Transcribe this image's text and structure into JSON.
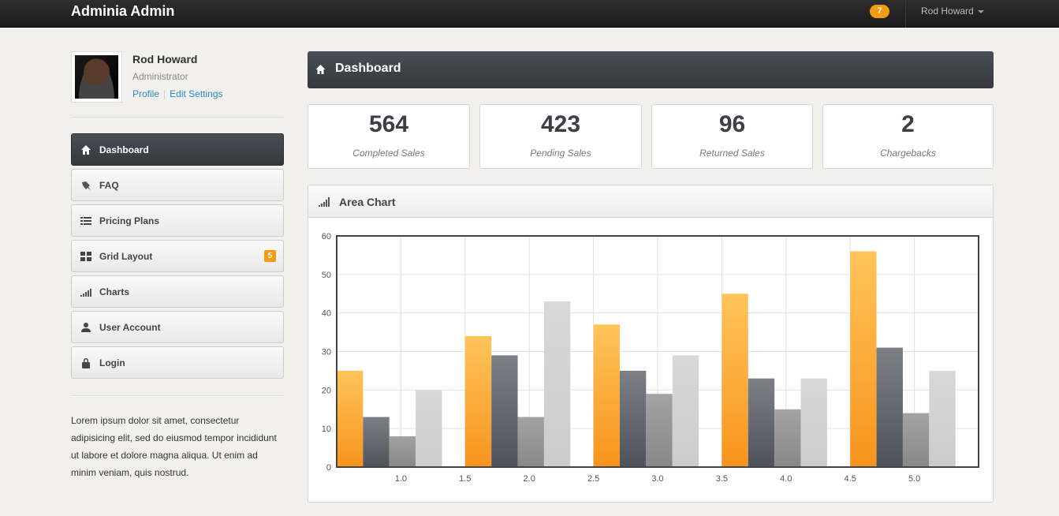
{
  "app": {
    "brand": "Adminia Admin",
    "notifications": "7",
    "user_menu": "Rod Howard"
  },
  "profile": {
    "name": "Rod Howard",
    "role": "Administrator",
    "profile_link": "Profile",
    "settings_link": "Edit Settings"
  },
  "nav": {
    "items": [
      {
        "label": "Dashboard",
        "icon": "home-icon"
      },
      {
        "label": "FAQ",
        "icon": "pushpin-icon"
      },
      {
        "label": "Pricing Plans",
        "icon": "list-icon"
      },
      {
        "label": "Grid Layout",
        "icon": "grid-icon",
        "badge": "5"
      },
      {
        "label": "Charts",
        "icon": "signal-icon"
      },
      {
        "label": "User Account",
        "icon": "user-icon"
      },
      {
        "label": "Login",
        "icon": "lock-icon"
      }
    ]
  },
  "sidebar_text": "Lorem ipsum dolor sit amet, consectetur adipisicing elit, sed do eiusmod tempor incididunt ut labore et dolore magna aliqua. Ut enim ad minim veniam, quis nostrud.",
  "header": {
    "title": "Dashboard"
  },
  "stats": [
    {
      "value": "564",
      "label": "Completed Sales"
    },
    {
      "value": "423",
      "label": "Pending Sales"
    },
    {
      "value": "96",
      "label": "Returned Sales"
    },
    {
      "value": "2",
      "label": "Chargebacks"
    }
  ],
  "panel": {
    "title": "Area Chart"
  },
  "colors": {
    "accent": "#f39c12",
    "dark": "#3c3f46"
  },
  "chart_data": {
    "type": "bar",
    "title": "",
    "xlabel": "",
    "ylabel": "",
    "xlim": [
      0.5,
      5.5
    ],
    "ylim": [
      0,
      60
    ],
    "xticks": [
      "1.0",
      "1.5",
      "2.0",
      "2.5",
      "3.0",
      "3.5",
      "4.0",
      "4.5",
      "5.0"
    ],
    "yticks": [
      "0",
      "10",
      "20",
      "30",
      "40",
      "50",
      "60"
    ],
    "grid": true,
    "categories": [
      1,
      2,
      3,
      4,
      5
    ],
    "series": [
      {
        "color": "#f7941d",
        "values": [
          25,
          34,
          37,
          45,
          56
        ]
      },
      {
        "color": "#4f525a",
        "values": [
          13,
          29,
          25,
          23,
          31
        ]
      },
      {
        "color": "#888888",
        "values": [
          8,
          13,
          19,
          15,
          14
        ]
      },
      {
        "color": "#cccccc",
        "values": [
          20,
          43,
          29,
          23,
          25
        ]
      }
    ]
  }
}
